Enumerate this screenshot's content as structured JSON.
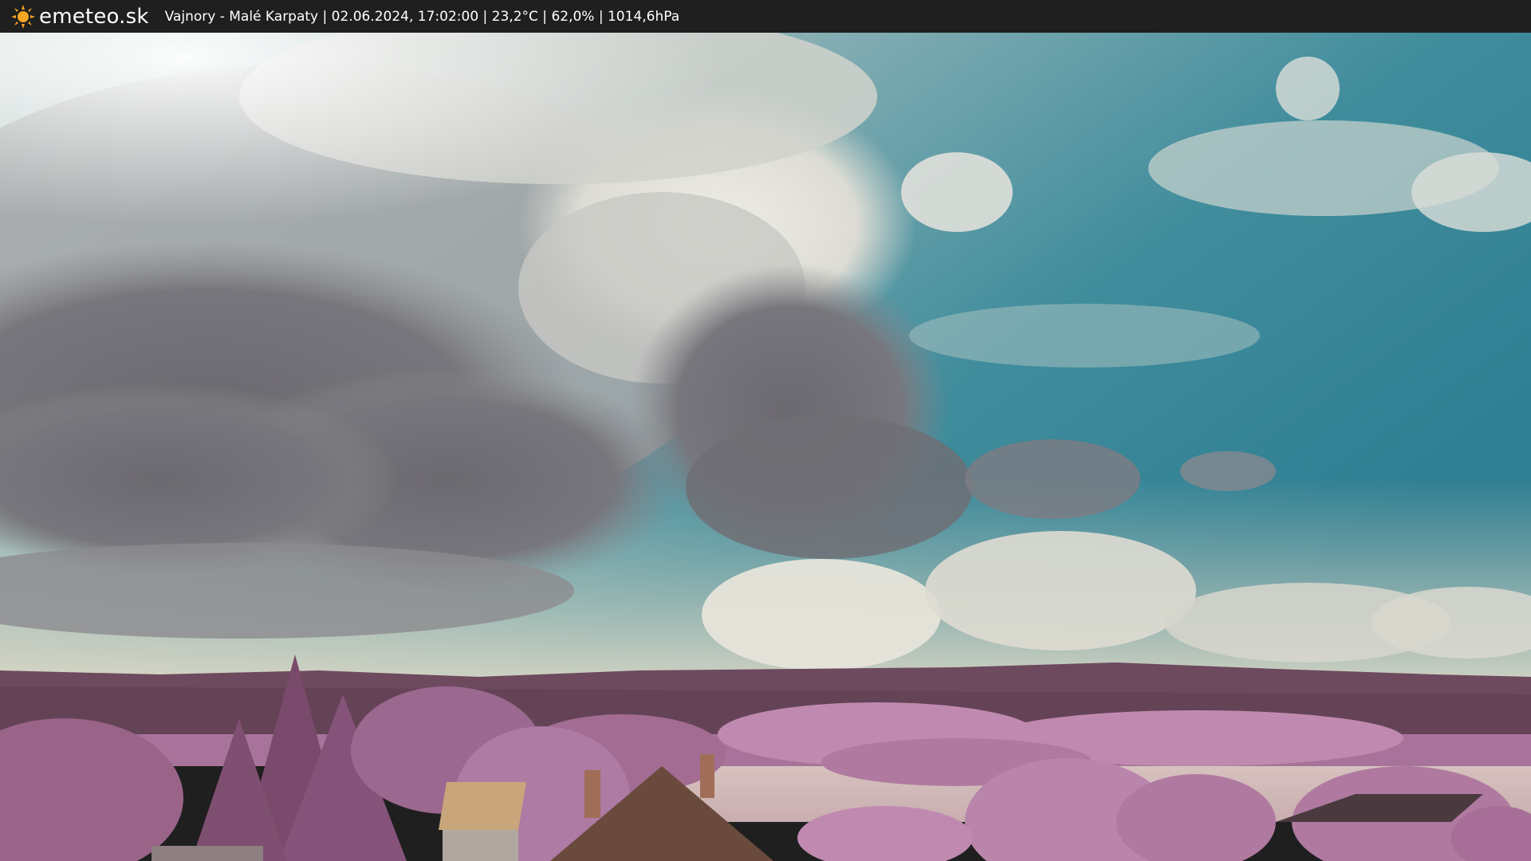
{
  "header": {
    "brand": "emeteo.sk",
    "caption": "Vajnory - Malé Karpaty | 02.06.2024, 17:02:00 | 23,2°C | 62,0% | 1014,6hPa",
    "logo_icon": "sun-icon",
    "background": "#1f1f1f",
    "logo_color": "#f5a623"
  },
  "webcam": {
    "sky_color": "#3e8fa0",
    "foliage_color": "#b07aa0",
    "hills_color": "#6e4a5e"
  }
}
